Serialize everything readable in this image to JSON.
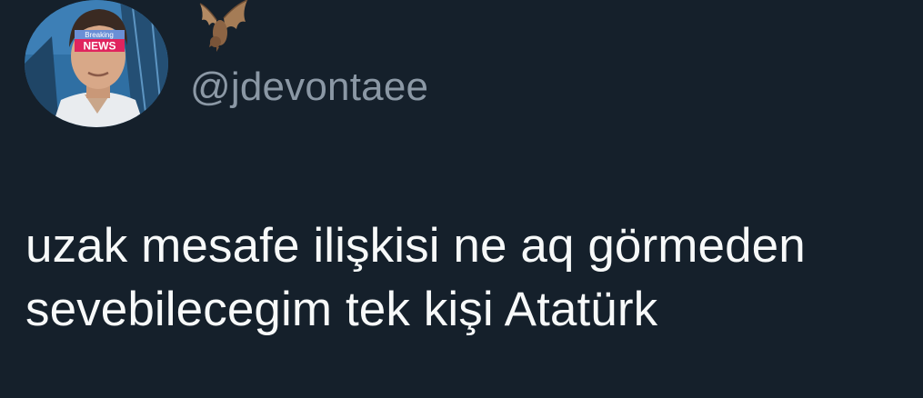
{
  "author": {
    "name_emoji": "🦇",
    "handle": "@jdevontaee",
    "avatar_badge_top": "Breaking",
    "avatar_badge_main": "NEWS"
  },
  "tweet": {
    "lines": [
      "uzak mesafe ilişkisi ne aq görmeden",
      "sevebilecegim tek kişi Atatürk"
    ]
  },
  "colors": {
    "background": "#15202b",
    "text": "#f7f9f9",
    "handle": "#8b98a5",
    "badge": "#e0245e"
  }
}
